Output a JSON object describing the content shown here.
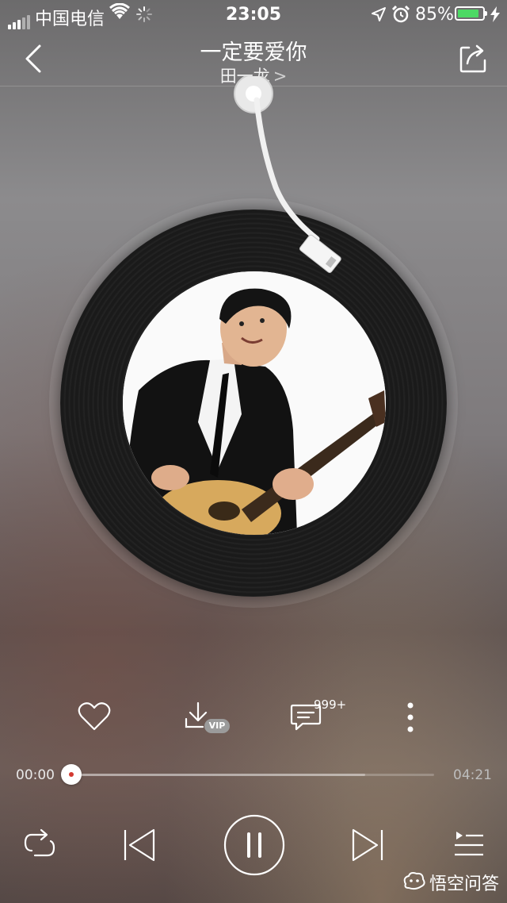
{
  "status_bar": {
    "carrier": "中国电信",
    "time": "23:05",
    "battery_percent": "85%",
    "battery_level": 0.85,
    "battery_color": "#4cd964"
  },
  "header": {
    "song_title": "一定要爱你",
    "artist": "田一龙",
    "artist_chevron": ">"
  },
  "actions": {
    "comment_count": "999+",
    "download_badge": "VIP"
  },
  "progress": {
    "current_time": "00:00",
    "total_time": "04:21",
    "played_fraction": 0.0,
    "buffered_fraction": 0.81,
    "accent_color": "#d33a31"
  },
  "icons": {
    "back": "chevron-left-icon",
    "share": "share-icon",
    "like": "heart-icon",
    "download": "download-icon",
    "comment": "comment-icon",
    "more": "more-vertical-icon",
    "repeat": "repeat-icon",
    "previous": "previous-icon",
    "play_pause": "pause-icon",
    "next": "next-icon",
    "playlist": "playlist-icon"
  },
  "watermark": {
    "text": "悟空问答"
  }
}
